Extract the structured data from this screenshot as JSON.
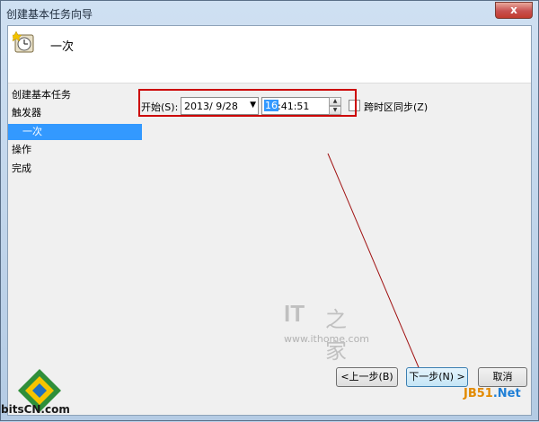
{
  "window": {
    "title": "创建基本任务向导",
    "close_label": "x"
  },
  "header": {
    "title": "一次",
    "icon": "clock-task-icon"
  },
  "nav": {
    "items": [
      {
        "label": "创建基本任务",
        "selected": false
      },
      {
        "label": "触发器",
        "selected": false
      },
      {
        "label": "一次",
        "selected": true
      },
      {
        "label": "操作",
        "selected": false
      },
      {
        "label": "完成",
        "selected": false
      }
    ]
  },
  "form": {
    "start_label": "开始(S):",
    "date_value": "2013/ 9/28",
    "time_hour": "16",
    "time_rest": ":41:51",
    "sync_label": "跨时区同步(Z)",
    "sync_checked": false
  },
  "buttons": {
    "prev": "<上一步(B)",
    "next": "下一步(N) >",
    "cancel": "取消"
  },
  "watermark": {
    "logo_text": "IT",
    "logo_cn": "之家",
    "url": "www.ithome.com"
  },
  "brand": {
    "site_a": "JB51",
    "site_b": ".Net",
    "bits": "bitsCN.com"
  },
  "colors": {
    "selection": "#3399ff",
    "highlight_box": "#cc0000",
    "arrow": "#a01010"
  }
}
